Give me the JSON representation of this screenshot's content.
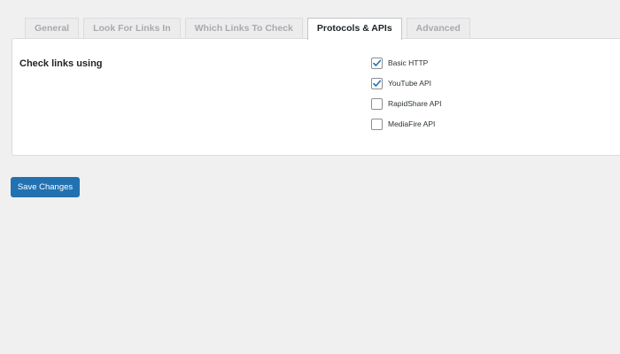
{
  "tabs": [
    {
      "label": "General",
      "active": false
    },
    {
      "label": "Look For Links In",
      "active": false
    },
    {
      "label": "Which Links To Check",
      "active": false
    },
    {
      "label": "Protocols & APIs",
      "active": true
    },
    {
      "label": "Advanced",
      "active": false
    }
  ],
  "panel": {
    "row_label": "Check links using",
    "options": [
      {
        "label": "Basic HTTP",
        "checked": true
      },
      {
        "label": "YouTube API",
        "checked": true
      },
      {
        "label": "RapidShare API",
        "checked": false
      },
      {
        "label": "MediaFire API",
        "checked": false
      }
    ]
  },
  "actions": {
    "save_label": "Save Changes"
  },
  "colors": {
    "accent": "#2271b1",
    "background": "#f0f0f1",
    "panel": "#ffffff"
  }
}
